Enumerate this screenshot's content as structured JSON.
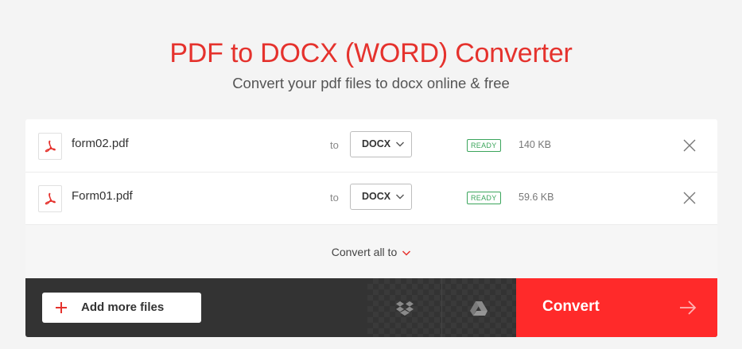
{
  "header": {
    "title": "PDF to DOCX (WORD) Converter",
    "subtitle": "Convert your pdf files to docx online & free"
  },
  "files": [
    {
      "icon": "pdf-icon",
      "name": "form02.pdf",
      "to": "to",
      "format": "DOCX",
      "status": "READY",
      "size": "140 KB"
    },
    {
      "icon": "pdf-icon",
      "name": "Form01.pdf",
      "to": "to",
      "format": "DOCX",
      "status": "READY",
      "size": "59.6 KB"
    }
  ],
  "convert_all": {
    "label": "Convert all to"
  },
  "actions": {
    "add_files": "Add more files",
    "dropbox_icon": "dropbox-icon",
    "gdrive_icon": "google-drive-icon",
    "convert": "Convert"
  },
  "colors": {
    "accent": "#e5322d",
    "convert_button": "#ff2a2a",
    "ready": "#3ba55c",
    "bar": "#333333"
  }
}
